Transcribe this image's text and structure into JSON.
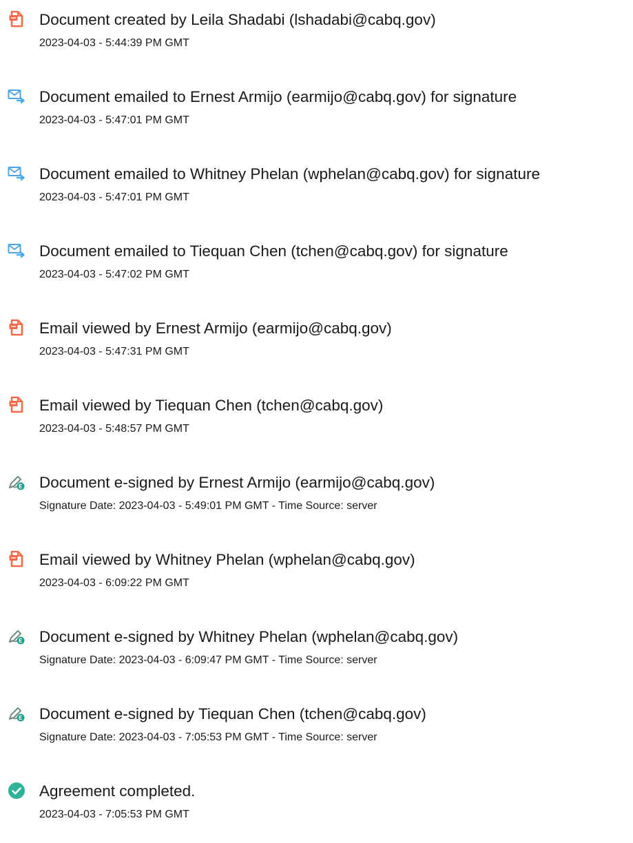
{
  "colors": {
    "pdf_icon": "#f26b4a",
    "email_icon": "#4aa8e8",
    "sign_icon_pen": "#6f8f7c",
    "sign_icon_badge": "#1f9e8a",
    "check_icon": "#2eb398",
    "text": "#1a1a1a"
  },
  "events": [
    {
      "icon": "document-created-icon",
      "title": "Document created by Leila Shadabi (lshadabi@cabq.gov)",
      "detail": "2023-04-03 - 5:44:39 PM GMT"
    },
    {
      "icon": "email-sent-icon",
      "title": "Document emailed to Ernest Armijo (earmijo@cabq.gov) for signature",
      "detail": "2023-04-03 - 5:47:01 PM GMT"
    },
    {
      "icon": "email-sent-icon",
      "title": "Document emailed to Whitney Phelan (wphelan@cabq.gov) for signature",
      "detail": "2023-04-03 - 5:47:01 PM GMT"
    },
    {
      "icon": "email-sent-icon",
      "title": "Document emailed to Tiequan Chen (tchen@cabq.gov) for signature",
      "detail": "2023-04-03 - 5:47:02 PM GMT"
    },
    {
      "icon": "email-viewed-icon",
      "title": "Email viewed by Ernest Armijo (earmijo@cabq.gov)",
      "detail": "2023-04-03 - 5:47:31 PM GMT"
    },
    {
      "icon": "email-viewed-icon",
      "title": "Email viewed by Tiequan Chen (tchen@cabq.gov)",
      "detail": "2023-04-03 - 5:48:57 PM GMT"
    },
    {
      "icon": "e-sign-icon",
      "title": "Document e-signed by Ernest Armijo (earmijo@cabq.gov)",
      "detail": "Signature Date: 2023-04-03 - 5:49:01 PM GMT - Time Source: server"
    },
    {
      "icon": "email-viewed-icon",
      "title": "Email viewed by Whitney Phelan (wphelan@cabq.gov)",
      "detail": "2023-04-03 - 6:09:22 PM GMT"
    },
    {
      "icon": "e-sign-icon",
      "title": "Document e-signed by Whitney Phelan (wphelan@cabq.gov)",
      "detail": "Signature Date: 2023-04-03 - 6:09:47 PM GMT - Time Source: server"
    },
    {
      "icon": "e-sign-icon",
      "title": "Document e-signed by Tiequan Chen (tchen@cabq.gov)",
      "detail": "Signature Date: 2023-04-03 - 7:05:53 PM GMT - Time Source: server"
    },
    {
      "icon": "check-circle-icon",
      "title": "Agreement completed.",
      "detail": "2023-04-03 - 7:05:53 PM GMT"
    }
  ]
}
